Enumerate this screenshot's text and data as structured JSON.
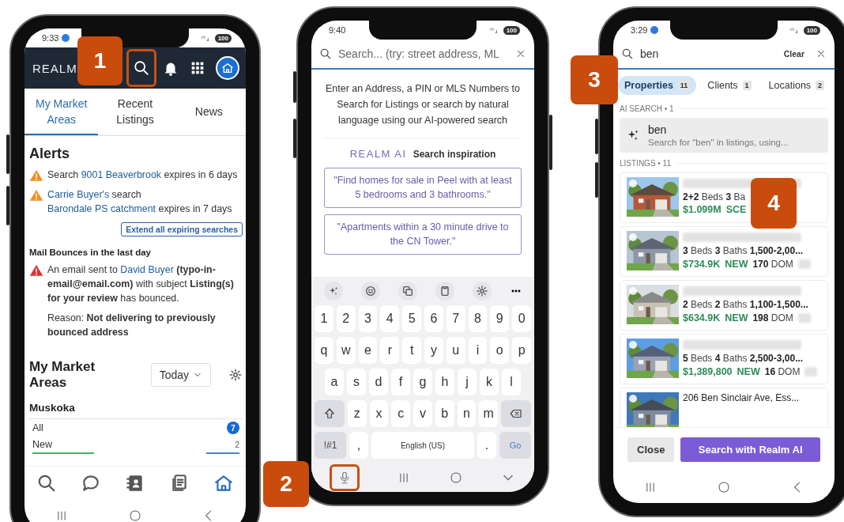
{
  "home_screen": {
    "status_bar": {
      "time": "9:33",
      "battery": "100"
    },
    "logo": "REALM",
    "tabs": [
      {
        "label": "My Market Areas",
        "selected": true
      },
      {
        "label": "Recent Listings",
        "selected": false
      },
      {
        "label": "News",
        "selected": false
      }
    ],
    "alerts_title": "Alerts",
    "alerts": [
      {
        "kind": "warning",
        "segments": [
          {
            "kind": "text",
            "text": "Search "
          },
          {
            "kind": "link",
            "text": "9001 Beaverbrook"
          },
          {
            "kind": "text",
            "text": " expires in 6 days"
          }
        ]
      },
      {
        "kind": "warning",
        "segments": [
          {
            "kind": "link",
            "text": "Carrie Buyer's"
          },
          {
            "kind": "text",
            "text": " search "
          },
          {
            "kind": "link",
            "text": "Barondale PS catchment"
          },
          {
            "kind": "text",
            "text": " expires in 7 days"
          }
        ]
      }
    ],
    "extend_button": "Extend all expiring searches",
    "bounces_title": "Mail Bounces in the last day",
    "bounces": [
      {
        "kind": "error",
        "segments": [
          {
            "kind": "text",
            "text": "An email sent to "
          },
          {
            "kind": "link",
            "text": "David Buyer"
          },
          {
            "kind": "text",
            "text": " **(typo-in-email@email.com)** with subject **Listing(s) for your review** has bounced."
          }
        ],
        "reason": "Reason: **Not delivering to previously bounced address**"
      }
    ],
    "market_title": "My Market Areas",
    "period": "Today",
    "area": "Muskoka",
    "market_rows": [
      {
        "kind": "badge",
        "label": "All",
        "count": "7"
      },
      {
        "kind": "plain",
        "label": "New",
        "count": "2"
      }
    ],
    "bottom_nav": [
      {
        "kind": "search",
        "selected": false
      },
      {
        "kind": "chat",
        "selected": false
      },
      {
        "kind": "contacts",
        "selected": false
      },
      {
        "kind": "documents",
        "selected": false
      },
      {
        "kind": "home",
        "selected": true
      }
    ]
  },
  "search_screen": {
    "status_bar": {
      "time": "9:40",
      "battery": "100"
    },
    "search_placeholder": "Search... (try: street address, ML",
    "intro": "Enter an Address, a PIN or MLS Numbers to Search for Listings or search by natural language using our AI-powered search",
    "logo": "REALM AI",
    "inspiration_title": "Search inspiration",
    "suggestions": [
      "\"Find homes for sale in Peel with at least 5 bedrooms and 3 bathrooms.\"",
      "\"Apartments within a 30 minute drive to the CN Tower.\""
    ],
    "keyboard": {
      "rows": [
        [
          "1",
          "2",
          "3",
          "4",
          "5",
          "6",
          "7",
          "8",
          "9",
          "0"
        ],
        [
          "q",
          "w",
          "e",
          "r",
          "t",
          "y",
          "u",
          "i",
          "o",
          "p"
        ],
        [
          "a",
          "s",
          "d",
          "f",
          "g",
          "h",
          "j",
          "k",
          "l"
        ],
        [
          "z",
          "x",
          "c",
          "v",
          "b",
          "n",
          "m"
        ]
      ],
      "symbols": "!#1",
      "comma": ",",
      "space": "English (US)",
      "period": ".",
      "action": "Go"
    }
  },
  "results_screen": {
    "status_bar": {
      "time": "3:29",
      "battery": "100"
    },
    "query": "ben",
    "clear": "Clear",
    "categories": [
      {
        "label": "Properties",
        "count": "11",
        "selected": true
      },
      {
        "label": "Clients",
        "count": "1",
        "selected": false
      },
      {
        "label": "Locations",
        "count": "2",
        "selected": false
      }
    ],
    "ai_section": "AI SEARCH • 1",
    "ai_result": {
      "title": "ben",
      "subtitle": "Search for \"ben\" in listings, using..."
    },
    "listings_section": "LISTINGS • 11",
    "listings": [
      {
        "selected": false,
        "specs": "**2+2** Beds **3** Ba",
        "price": "$1.099M",
        "status": "SCE"
      },
      {
        "selected": false,
        "specs": "**3** Beds **3** Baths **1,500-2,00...**",
        "price": "$734.9K",
        "status": "NEW",
        "dom": "**170** DOM"
      },
      {
        "selected": false,
        "specs": "**2** Beds **2** Baths **1,100-1,500...**",
        "price": "$634.9K",
        "status": "NEW",
        "dom": "**198** DOM"
      },
      {
        "selected": false,
        "specs": "**5** Beds **4** Baths **2,500-3,00...**",
        "price": "$1,389,800",
        "status": "NEW",
        "dom": "**16** DOM"
      },
      {
        "selected": false,
        "title": "206 Ben Sinclair Ave, Ess..."
      }
    ],
    "close_button": "Close",
    "ai_button": "Search with Realm AI"
  },
  "callouts": [
    {
      "label": "1"
    },
    {
      "label": "2"
    },
    {
      "label": "3"
    },
    {
      "label": "4"
    }
  ]
}
